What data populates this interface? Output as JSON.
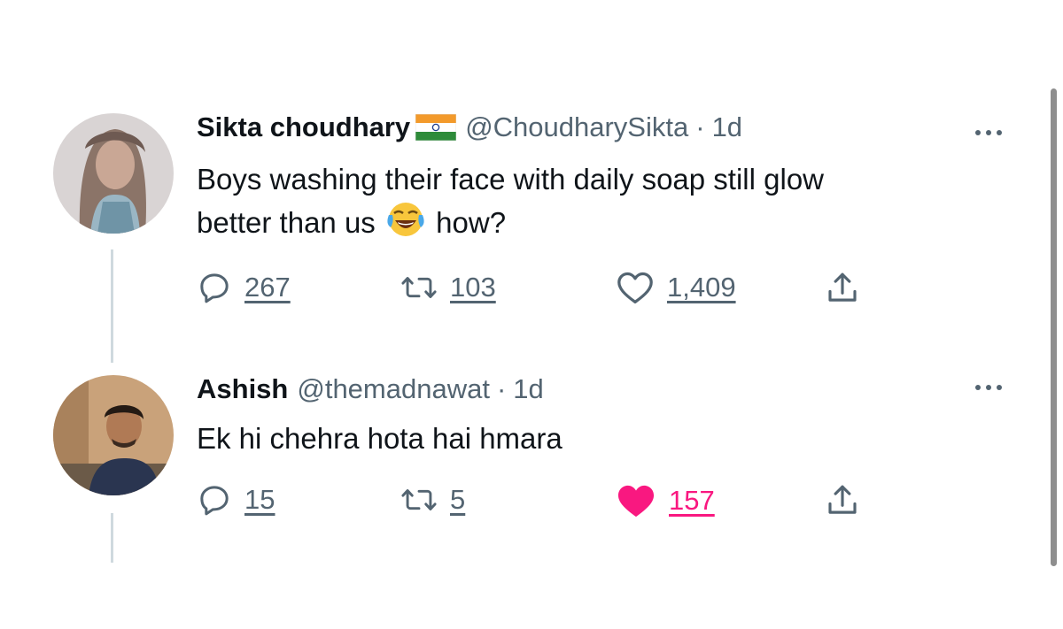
{
  "tweets": [
    {
      "name": "Sikta choudhary",
      "handle": "@ChoudharySikta",
      "dot": "·",
      "time": "1d",
      "flag_icon": "india-flag-icon",
      "text_line1": "Boys washing their face with daily soap still glow",
      "text_line2_before": "better than us",
      "emoji_icon": "face-with-tears-of-joy-icon",
      "text_line2_after": "how?",
      "replies": "267",
      "retweets": "103",
      "likes": "1,409",
      "liked": false
    },
    {
      "name": "Ashish",
      "handle": "@themadnawat",
      "dot": "·",
      "time": "1d",
      "text_line1": "Ek hi chehra hota hai hmara",
      "replies": "15",
      "retweets": "5",
      "likes": "157",
      "liked": true
    }
  ],
  "colors": {
    "text": "#0f1419",
    "secondary": "#536471",
    "like_active": "#f91880",
    "thread_line": "#cfd9de"
  }
}
